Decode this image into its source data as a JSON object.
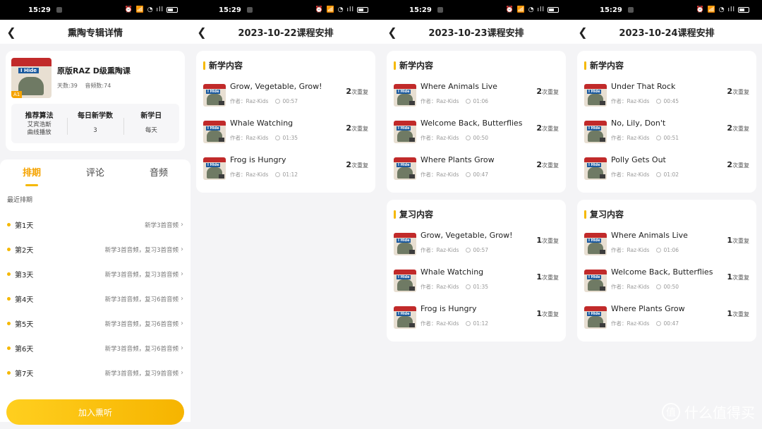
{
  "status_bar": {
    "time": "15:29",
    "icons": "⏰ 📶 ◔ ıll"
  },
  "screen1": {
    "nav_title": "熏陶专辑详情",
    "album": {
      "cover_label": "I Hide",
      "level_badge": "A1",
      "name": "原版RAZ D级熏陶课",
      "days": "天数:39",
      "audios": "音频数:74"
    },
    "stats": [
      {
        "label": "推荐算法",
        "value": "艾宾浩斯\n曲线播放"
      },
      {
        "label": "每日新学数",
        "value": "3"
      },
      {
        "label": "新学日",
        "value": "每天"
      }
    ],
    "tabs": [
      "排期",
      "评论",
      "音频"
    ],
    "recent_label": "最近排期",
    "days": [
      {
        "name": "第1天",
        "desc": "新学3首音频"
      },
      {
        "name": "第2天",
        "desc": "新学3首音频，复习3首音频"
      },
      {
        "name": "第3天",
        "desc": "新学3首音频，复习3首音频"
      },
      {
        "name": "第4天",
        "desc": "新学3首音频，复习6首音频"
      },
      {
        "name": "第5天",
        "desc": "新学3首音频，复习6首音频"
      },
      {
        "name": "第6天",
        "desc": "新学3首音频，复习6首音频"
      },
      {
        "name": "第7天",
        "desc": "新学3首音频，复习9首音频"
      }
    ],
    "join_button": "加入熏听"
  },
  "labels": {
    "new_section": "新学内容",
    "review_section": "复习内容",
    "repeat_suffix": "次重复",
    "author_prefix": "作者：",
    "thumb_label": "I Hide"
  },
  "screen2": {
    "nav_title": "2023-10-22课程安排",
    "new_items": [
      {
        "title": "Grow, Vegetable, Grow!",
        "author": "Raz-Kids",
        "duration": "00:57",
        "repeat": "2"
      },
      {
        "title": "Whale Watching",
        "author": "Raz-Kids",
        "duration": "01:35",
        "repeat": "2"
      },
      {
        "title": "Frog is Hungry",
        "author": "Raz-Kids",
        "duration": "01:12",
        "repeat": "2"
      }
    ]
  },
  "screen3": {
    "nav_title": "2023-10-23课程安排",
    "new_items": [
      {
        "title": "Where Animals Live",
        "author": "Raz-Kids",
        "duration": "01:06",
        "repeat": "2"
      },
      {
        "title": "Welcome Back, Butterflies",
        "author": "Raz-Kids",
        "duration": "00:50",
        "repeat": "2"
      },
      {
        "title": "Where Plants Grow",
        "author": "Raz-Kids",
        "duration": "00:47",
        "repeat": "2"
      }
    ],
    "review_items": [
      {
        "title": "Grow, Vegetable, Grow!",
        "author": "Raz-Kids",
        "duration": "00:57",
        "repeat": "1"
      },
      {
        "title": "Whale Watching",
        "author": "Raz-Kids",
        "duration": "01:35",
        "repeat": "1"
      },
      {
        "title": "Frog is Hungry",
        "author": "Raz-Kids",
        "duration": "01:12",
        "repeat": "1"
      }
    ]
  },
  "screen4": {
    "nav_title": "2023-10-24课程安排",
    "new_items": [
      {
        "title": "Under That Rock",
        "author": "Raz-Kids",
        "duration": "00:45",
        "repeat": "2"
      },
      {
        "title": "No, Lily, Don't",
        "author": "Raz-Kids",
        "duration": "00:51",
        "repeat": "2"
      },
      {
        "title": "Polly Gets Out",
        "author": "Raz-Kids",
        "duration": "01:02",
        "repeat": "2"
      }
    ],
    "review_items": [
      {
        "title": "Where Animals Live",
        "author": "Raz-Kids",
        "duration": "01:06",
        "repeat": "1"
      },
      {
        "title": "Welcome Back, Butterflies",
        "author": "Raz-Kids",
        "duration": "00:50",
        "repeat": "1"
      },
      {
        "title": "Where Plants Grow",
        "author": "Raz-Kids",
        "duration": "00:47",
        "repeat": "1"
      }
    ]
  },
  "watermark": {
    "icon_char": "值",
    "text": "什么值得买"
  },
  "colors": {
    "accent": "#f5b800",
    "accent_text": "#f5a300"
  }
}
